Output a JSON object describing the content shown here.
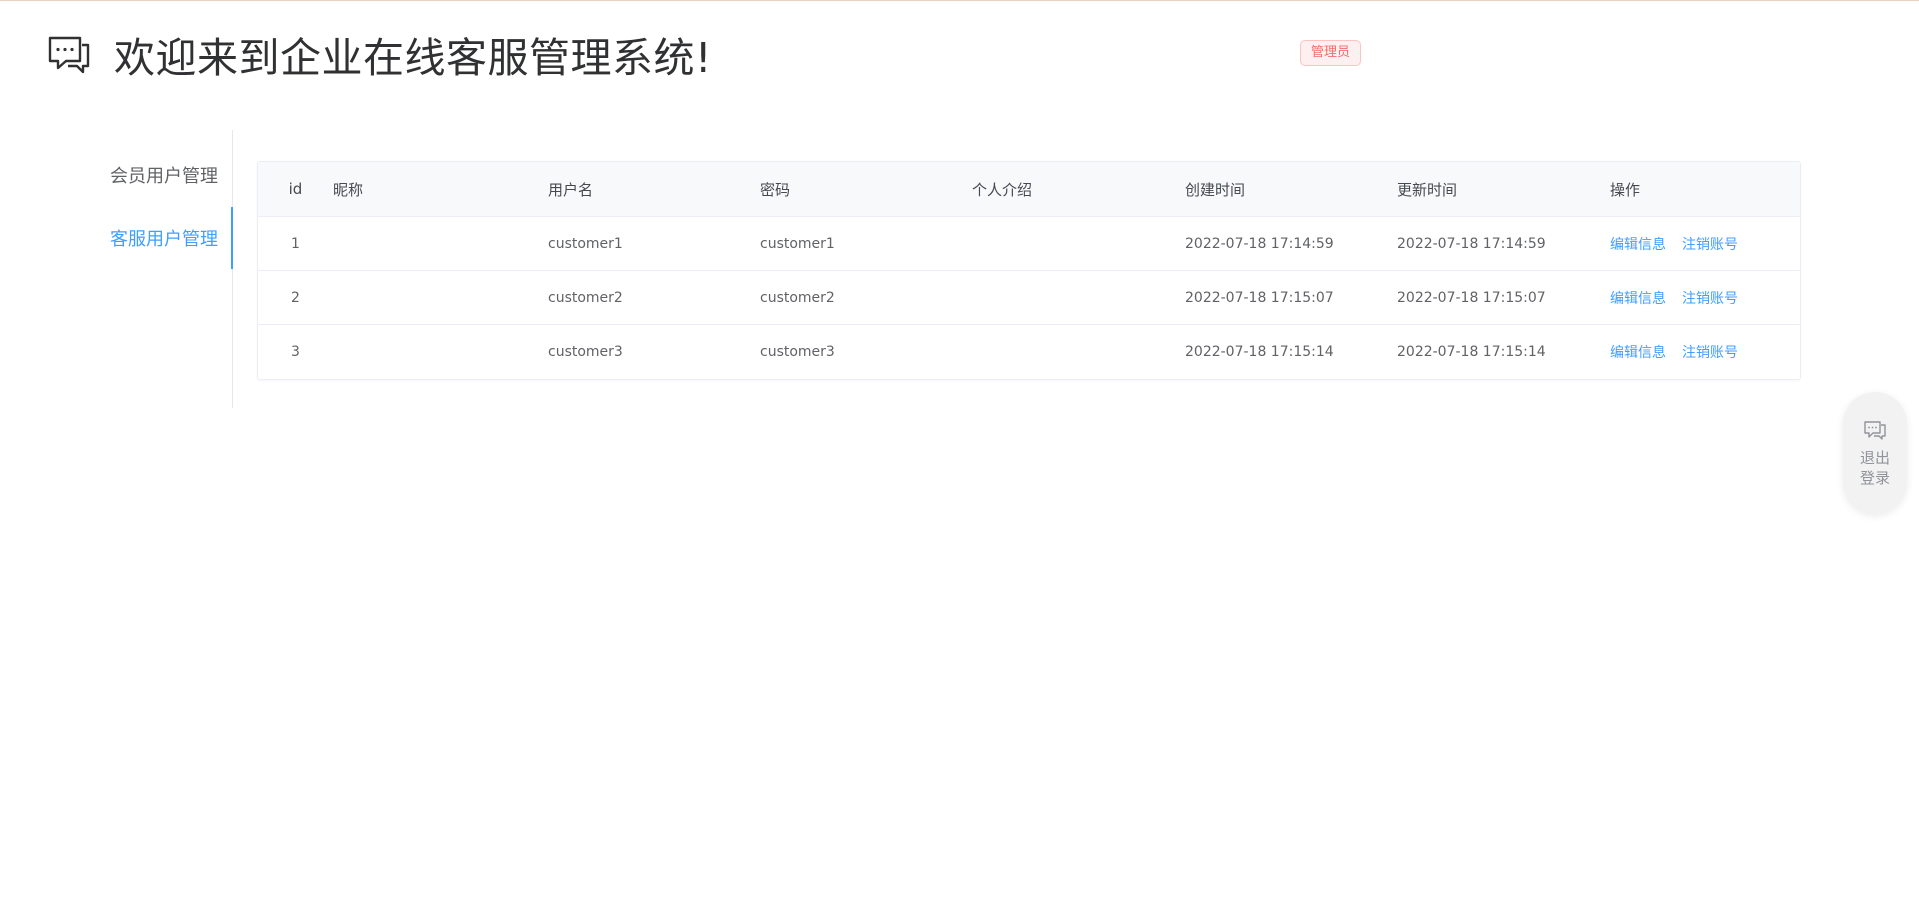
{
  "header": {
    "title": "欢迎来到企业在线客服管理系统!",
    "role_badge": "管理员"
  },
  "sidebar": {
    "items": [
      {
        "label": "会员用户管理",
        "active": false
      },
      {
        "label": "客服用户管理",
        "active": true
      }
    ]
  },
  "table": {
    "columns": [
      "id",
      "昵称",
      "用户名",
      "密码",
      "个人介绍",
      "创建时间",
      "更新时间",
      "操作"
    ],
    "rows": [
      {
        "id": "1",
        "nickname": "",
        "username": "customer1",
        "password": "customer1",
        "intro": "",
        "created": "2022-07-18 17:14:59",
        "updated": "2022-07-18 17:14:59"
      },
      {
        "id": "2",
        "nickname": "",
        "username": "customer2",
        "password": "customer2",
        "intro": "",
        "created": "2022-07-18 17:15:07",
        "updated": "2022-07-18 17:15:07"
      },
      {
        "id": "3",
        "nickname": "",
        "username": "customer3",
        "password": "customer3",
        "intro": "",
        "created": "2022-07-18 17:15:14",
        "updated": "2022-07-18 17:15:14"
      }
    ],
    "actions": {
      "edit": "编辑信息",
      "deactivate": "注销账号"
    }
  },
  "float_button": {
    "label": "退出登录",
    "icon": "chat-icon"
  },
  "colors": {
    "accent": "#409eff",
    "danger": "#f56c6c",
    "text": "#606266",
    "title": "#303133"
  }
}
